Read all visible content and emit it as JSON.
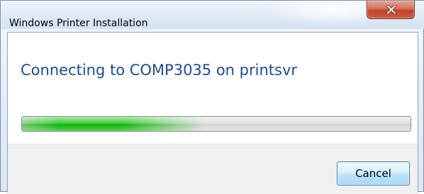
{
  "window": {
    "title": "Windows Printer Installation",
    "close_icon": "close-icon"
  },
  "content": {
    "main_instruction": "Connecting to COMP3035 on printsvr"
  },
  "progress": {
    "state": "indeterminate",
    "fill_fraction": 0.47,
    "color": "#17b012"
  },
  "footer": {
    "cancel_label": "Cancel"
  },
  "colors": {
    "instruction_text": "#1e4a96",
    "close_button": "#c2412b",
    "default_button_border": "#3c7fb1"
  }
}
